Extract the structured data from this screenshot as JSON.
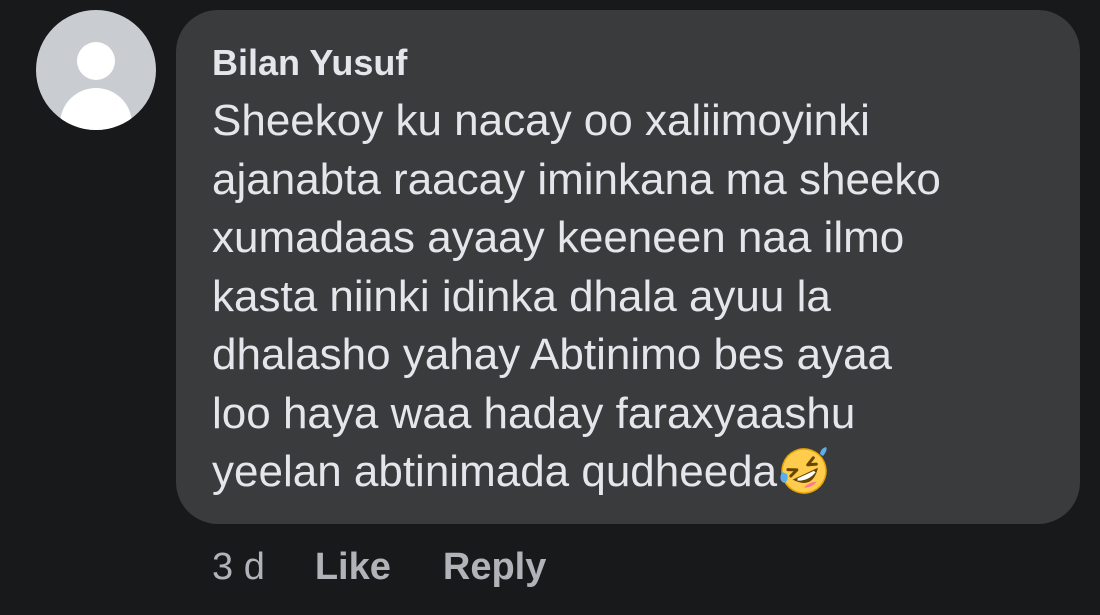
{
  "comment": {
    "author": "Bilan Yusuf",
    "text_lines": [
      "Sheekoy ku nacay oo xaliimoyinki",
      "ajanabta raacay iminkana ma sheeko",
      "xumadaas ayaay keeneen naa ilmo",
      "kasta niinki idinka dhala ayuu la",
      "dhalasho yahay Abtinimo bes ayaa",
      "loo haya waa haday faraxyaashu",
      "yeelan abtinimada qudheeda"
    ],
    "emoji": "rolling-on-the-floor-laughing-emoji",
    "timestamp": "3 d",
    "like_label": "Like",
    "reply_label": "Reply"
  },
  "colors": {
    "background": "#18191a",
    "bubble": "#3a3b3c",
    "text": "#e4e6eb",
    "meta": "#b0b3b8",
    "avatar_bg": "#c9ccd1"
  }
}
